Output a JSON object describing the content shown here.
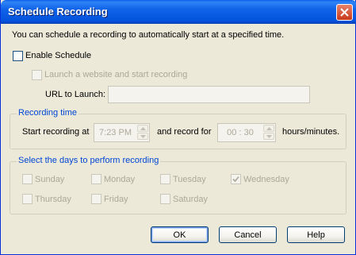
{
  "window": {
    "title": "Schedule Recording"
  },
  "intro": "You can schedule a recording to automatically start at a specified time.",
  "enable_schedule": {
    "label": "Enable Schedule",
    "checked": false
  },
  "launch_website": {
    "label": "Launch a website and start recording",
    "checked": false
  },
  "url": {
    "label": "URL to Launch:",
    "value": ""
  },
  "recording_time": {
    "legend": "Recording time",
    "start_label": "Start recording at",
    "start_value": "7:23 PM",
    "duration_label": "and record for",
    "duration_value": "00 : 30",
    "units": "hours/minutes."
  },
  "days": {
    "legend": "Select the days to perform recording",
    "items": [
      {
        "label": "Sunday",
        "checked": false
      },
      {
        "label": "Monday",
        "checked": false
      },
      {
        "label": "Tuesday",
        "checked": false
      },
      {
        "label": "Wednesday",
        "checked": true
      },
      {
        "label": "Thursday",
        "checked": false
      },
      {
        "label": "Friday",
        "checked": false
      },
      {
        "label": "Saturday",
        "checked": false
      }
    ]
  },
  "buttons": {
    "ok": "OK",
    "cancel": "Cancel",
    "help": "Help"
  },
  "colors": {
    "title_bar": "#0a5ee8",
    "legend": "#0046d5",
    "disabled_text": "#aca899",
    "dialog_bg": "#ece9d8"
  }
}
